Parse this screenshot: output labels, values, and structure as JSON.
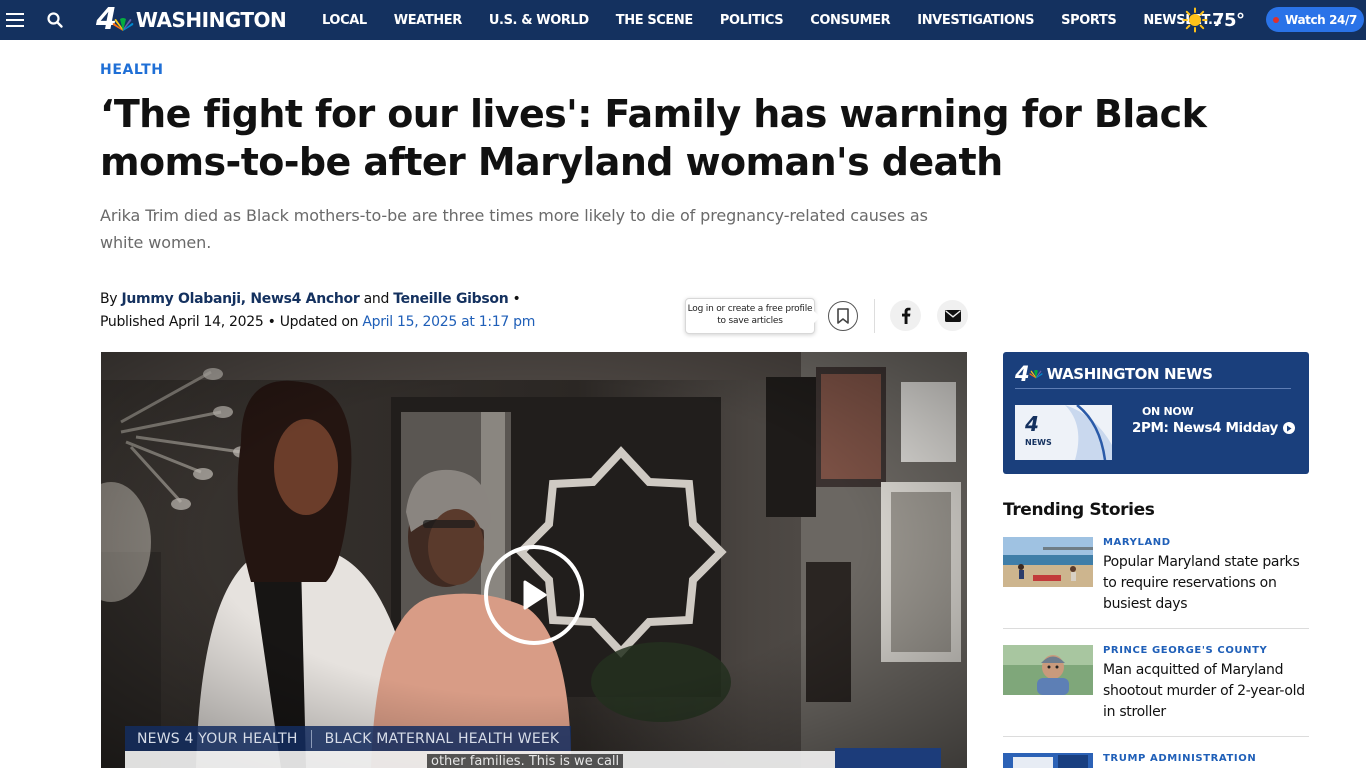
{
  "nav": {
    "logo_number": "4",
    "logo_text": "WASHINGTON",
    "links": [
      "LOCAL",
      "WEATHER",
      "U.S. & WORLD",
      "THE SCENE",
      "POLITICS",
      "CONSUMER",
      "INVESTIGATIONS",
      "SPORTS",
      "NEWSLET..."
    ],
    "temperature": "75°",
    "weather_icon": "sun-icon",
    "watch_label": "Watch 24/7"
  },
  "article": {
    "section": "HEALTH",
    "headline": "‘The fight for our lives': Family has warning for Black moms-to-be after Maryland woman's death",
    "dek": "Arika Trim died as Black mothers-to-be are three times more likely to die of pregnancy-related causes as white women.",
    "byline": {
      "by": "By",
      "author1": "Jummy Olabanji, News4 Anchor",
      "and": "and",
      "author2": "Teneille Gibson",
      "bullet": "•",
      "published": "Published April 14, 2025 •",
      "updated_prefix": "Updated on",
      "updated_date": "April 15, 2025",
      "updated_time": "at 1:17 pm"
    },
    "save_tooltip": "Log in or create a free profile to save articles",
    "share_icons": [
      "bookmark-icon",
      "facebook-icon",
      "email-icon"
    ]
  },
  "video": {
    "lower_third_left": "NEWS 4 YOUR HEALTH",
    "lower_third_right": "BLACK MATERNAL HEALTH WEEK",
    "caption": "other families. This is we call"
  },
  "sidebar": {
    "live_card": {
      "logo_number": "4",
      "title": "WASHINGTON NEWS",
      "thumb_text": "NEWS",
      "on_now": "ON NOW",
      "show": "2PM: News4 Midday"
    },
    "trending_title": "Trending Stories",
    "stories": [
      {
        "label": "MARYLAND",
        "headline": "Popular Maryland state parks to require reservations on busiest days"
      },
      {
        "label": "PRINCE GEORGE'S COUNTY",
        "headline": "Man acquitted of Maryland shootout murder of 2-year-old in stroller"
      },
      {
        "label": "TRUMP ADMINISTRATION",
        "headline": ""
      }
    ]
  },
  "colors": {
    "nav_bg": "#14315f",
    "accent_blue": "#1f6fd6",
    "watch_button": "#2a73e8",
    "live_card_bg": "#1a3f7c"
  }
}
